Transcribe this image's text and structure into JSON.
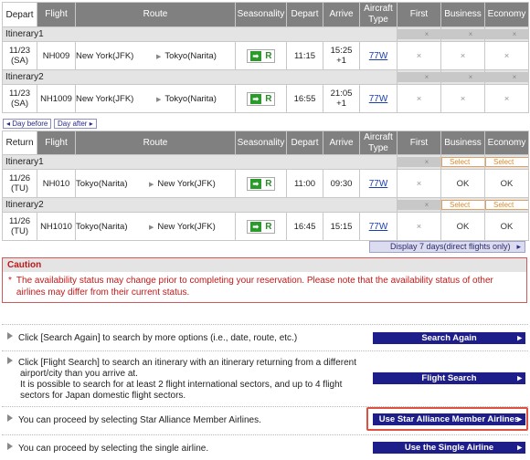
{
  "headers": {
    "flight": "Flight",
    "route": "Route",
    "seasonality": "Seasonality",
    "depart": "Depart",
    "arrive": "Arrive",
    "aircraft_type": "Aircraft Type",
    "first": "First",
    "business": "Business",
    "economy": "Economy"
  },
  "depart_table": {
    "label": "Depart",
    "itineraries": [
      {
        "label": "Itinerary1",
        "first": "×",
        "business": "×",
        "economy": "×",
        "date": "11/23\n(SA)",
        "flight": "NH009",
        "from": "New York(JFK)",
        "to": "Tokyo(Narita)",
        "season": "R",
        "depart": "11:15",
        "arrive": "15:25\n+1",
        "aircraft": "77W",
        "first_status": "×",
        "business_status": "×",
        "economy_status": "×"
      },
      {
        "label": "Itinerary2",
        "first": "×",
        "business": "×",
        "economy": "×",
        "date": "11/23\n(SA)",
        "flight": "NH1009",
        "from": "New York(JFK)",
        "to": "Tokyo(Narita)",
        "season": "R",
        "depart": "16:55",
        "arrive": "21:05\n+1",
        "aircraft": "77W",
        "first_status": "×",
        "business_status": "×",
        "economy_status": "×"
      }
    ]
  },
  "day_before": "Day before",
  "day_after": "Day after",
  "return_table": {
    "label": "Return",
    "itineraries": [
      {
        "label": "Itinerary1",
        "first": "×",
        "business": "Select",
        "economy": "Select",
        "date": "11/26\n(TU)",
        "flight": "NH010",
        "from": "Tokyo(Narita)",
        "to": "New York(JFK)",
        "season": "R",
        "depart": "11:00",
        "arrive": "09:30",
        "aircraft": "77W",
        "first_status": "×",
        "business_status": "OK",
        "economy_status": "OK"
      },
      {
        "label": "Itinerary2",
        "first": "×",
        "business": "Select",
        "economy": "Select",
        "date": "11/26\n(TU)",
        "flight": "NH1010",
        "from": "Tokyo(Narita)",
        "to": "New York(JFK)",
        "season": "R",
        "depart": "16:45",
        "arrive": "15:15",
        "aircraft": "77W",
        "first_status": "×",
        "business_status": "OK",
        "economy_status": "OK"
      }
    ]
  },
  "display_7_days": "Display 7 days(direct flights only)",
  "caution": {
    "title": "Caution",
    "text": "The availability status may change prior to completing your reservation. Please note that the availability status of other airlines may differ from their current status."
  },
  "options": [
    {
      "text": "Click [Search Again] to search by more options (i.e., date, route, etc.)",
      "button": "Search Again"
    },
    {
      "text": "Click [Flight Search] to search an itinerary with an itinerary returning from a different airport/city than you arrive at.\nIt is possible to search for at least 2 flight international sectors, and up to 4 flight sectors for Japan domestic flight sectors.",
      "button": "Flight Search"
    },
    {
      "text": "You can proceed by selecting Star Alliance Member Airlines.",
      "button": "Use Star Alliance Member Airlines"
    },
    {
      "text": "You can proceed by selecting the single airline.",
      "button": "Use the Single Airline"
    }
  ],
  "colors": {
    "header_bg": "#808080",
    "caution": "#c01818",
    "button_navy": "#1e1e8a",
    "highlight": "#e05040",
    "season_green": "#2a9a2a"
  }
}
